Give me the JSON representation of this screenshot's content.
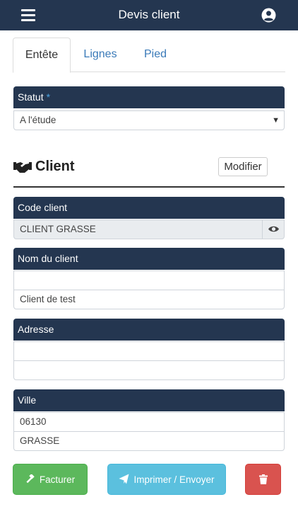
{
  "header": {
    "title": "Devis client"
  },
  "tabs": [
    {
      "label": "Entête"
    },
    {
      "label": "Lignes"
    },
    {
      "label": "Pied"
    }
  ],
  "statut": {
    "label": "Statut",
    "required_mark": "*",
    "value": "A l'étude"
  },
  "client_section": {
    "title": "Client",
    "modify_label": "Modifier"
  },
  "code_client": {
    "label": "Code client",
    "value": "CLIENT GRASSE"
  },
  "nom_client": {
    "label": "Nom du client",
    "line1": "",
    "line2": "Client de test"
  },
  "adresse": {
    "label": "Adresse",
    "line1": "",
    "line2": ""
  },
  "ville": {
    "label": "Ville",
    "postal_code": "06130",
    "city": "GRASSE"
  },
  "actions": {
    "invoice_label": "Facturer",
    "print_send_label": "Imprimer / Envoyer"
  },
  "colors": {
    "navbar": "#243650",
    "tab_link": "#3a7ab8",
    "required_star": "#4aa3df",
    "success": "#5cb85c",
    "info": "#5bc0de",
    "danger": "#d9534f"
  },
  "icons": {
    "menu": "hamburger-icon",
    "user": "user-circle-icon",
    "client": "handshake-icon",
    "view": "eye-icon",
    "invoice": "gavel-icon",
    "send": "paper-plane-icon",
    "delete": "trash-icon"
  }
}
